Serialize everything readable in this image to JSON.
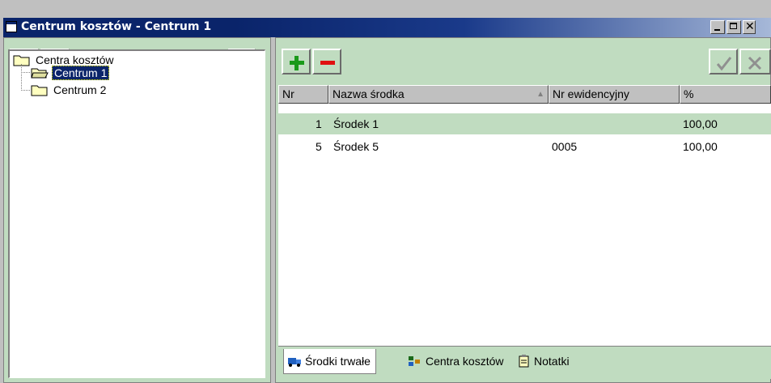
{
  "window": {
    "title": "Centrum kosztów - Centrum 1"
  },
  "left_toolbar": {
    "add_icon": "plus-icon",
    "remove_icon": "minus-icon",
    "tree_icon": "tree-structure-icon"
  },
  "tree": {
    "root": "Centra kosztów",
    "children": [
      "Centrum 1",
      "Centrum 2"
    ],
    "selected": "Centrum 1"
  },
  "right_toolbar": {
    "add_icon": "plus-icon",
    "remove_icon": "minus-icon",
    "confirm_icon": "check-icon",
    "cancel_icon": "cross-icon"
  },
  "grid": {
    "columns": [
      "Nr",
      "Nazwa środka",
      "Nr ewidencyjny",
      "%"
    ],
    "rows": [
      {
        "nr": "1",
        "nazwa": "Środek 1",
        "ewid": "",
        "pct": "100,00"
      },
      {
        "nr": "5",
        "nazwa": "Środek 5",
        "ewid": "0005",
        "pct": "100,00"
      }
    ]
  },
  "tabs": [
    "Środki trwałe",
    "Centra kosztów",
    "Notatki"
  ],
  "colors": {
    "title_bar": "#0a246a",
    "panel_bg": "#c0dcc0",
    "selection": "#0a246a",
    "add_green": "#1a9a1a",
    "remove_red": "#e01010"
  }
}
